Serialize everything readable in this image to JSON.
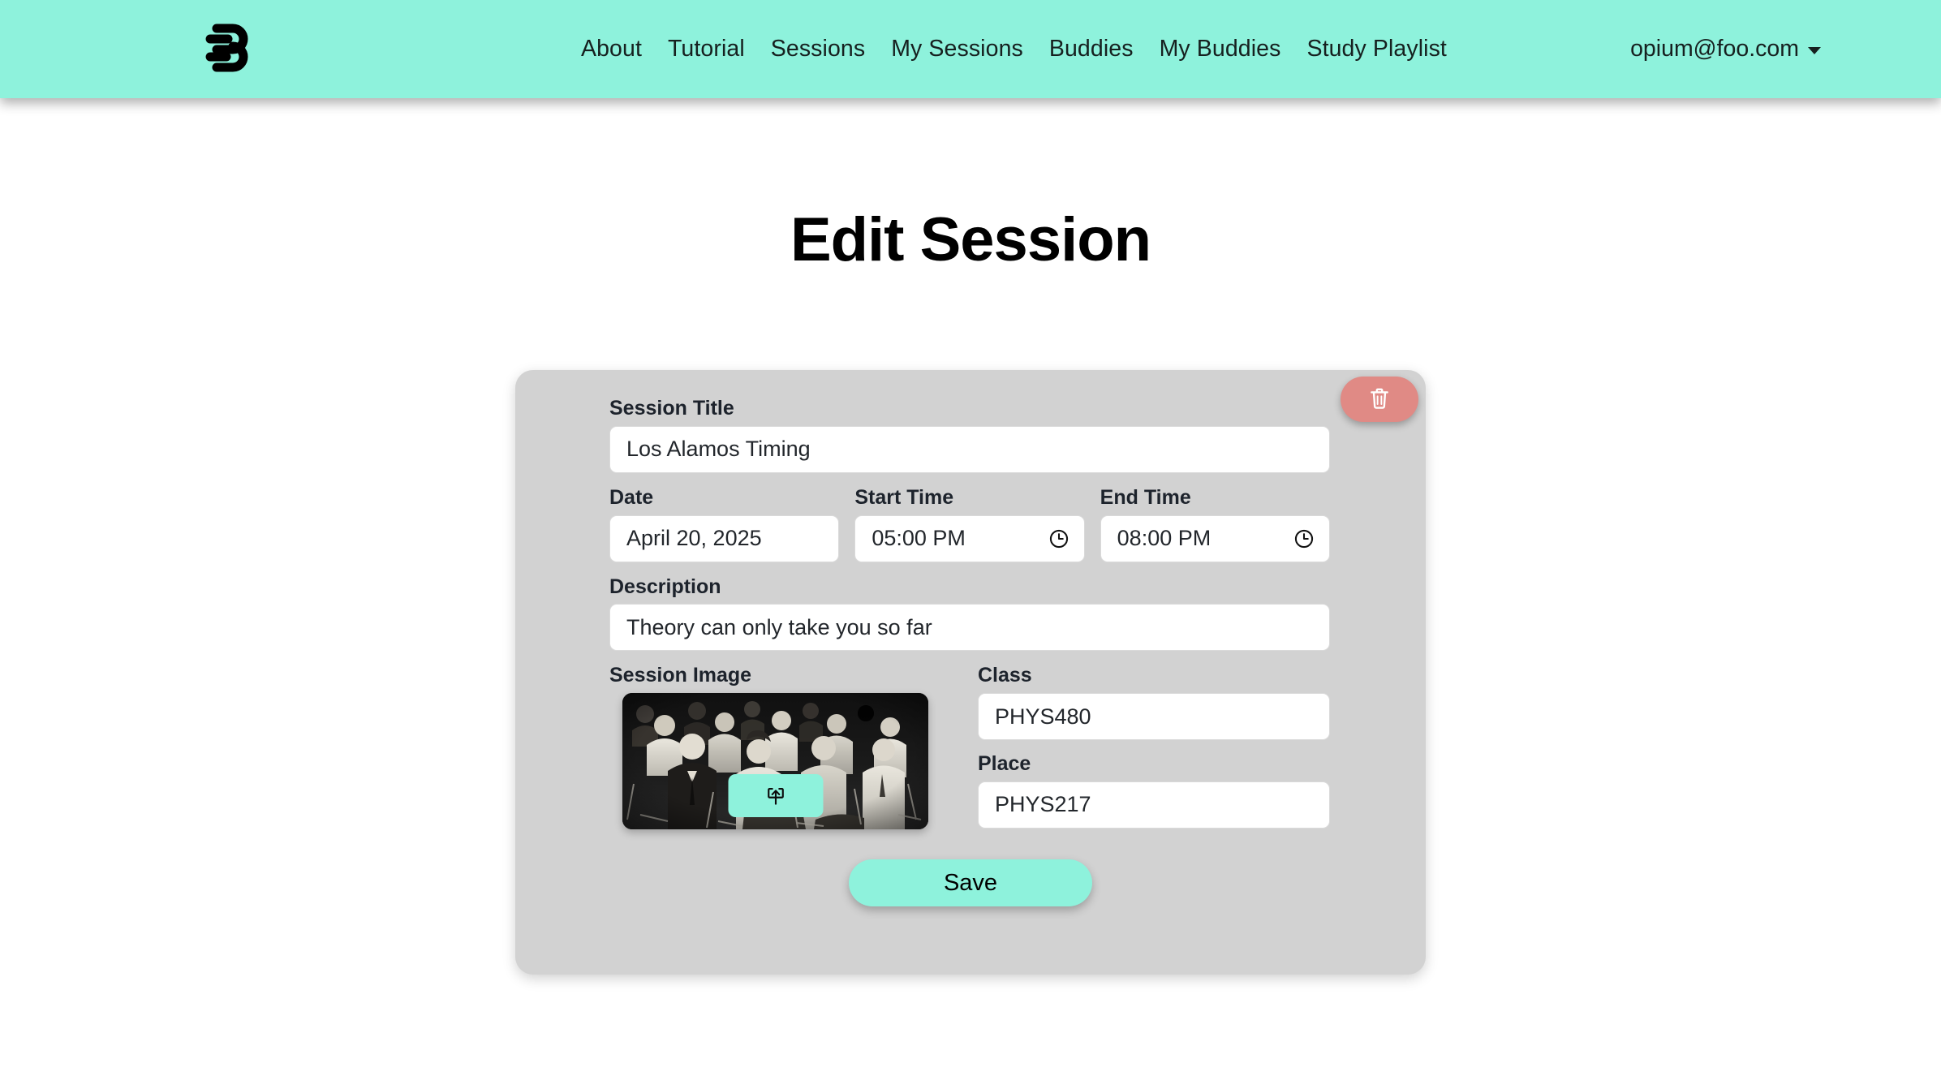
{
  "navbar": {
    "logo_icon": "studybuddy-logo-icon",
    "links": [
      {
        "label": "About"
      },
      {
        "label": "Tutorial"
      },
      {
        "label": "Sessions"
      },
      {
        "label": "My Sessions"
      },
      {
        "label": "Buddies"
      },
      {
        "label": "My Buddies"
      },
      {
        "label": "Study Playlist"
      }
    ],
    "user": {
      "email": "opium@foo.com",
      "caret_icon": "chevron-down-icon"
    },
    "background_color": "#8EF2DC"
  },
  "page": {
    "title": "Edit Session",
    "background_color": "#ffffff"
  },
  "card": {
    "background_color": "#d2d2d2",
    "delete_button": {
      "icon": "trash-icon",
      "color": "#e08a85"
    },
    "fields": {
      "session_title": {
        "label": "Session Title",
        "value": "Los Alamos Timing",
        "placeholder": "Session Title"
      },
      "date": {
        "label": "Date",
        "value": "April 20, 2025",
        "placeholder": "Date"
      },
      "start_time": {
        "label": "Start Time",
        "value": "05:00 PM",
        "placeholder": "Start Time",
        "icon": "clock-icon"
      },
      "end_time": {
        "label": "End Time",
        "value": "08:00 PM",
        "placeholder": "End Time",
        "icon": "clock-icon"
      },
      "description": {
        "label": "Description",
        "value": "Theory can only take you so far",
        "placeholder": "Description"
      },
      "session_image": {
        "label": "Session Image",
        "alt": "Black and white photo of an audience seated in folding chairs at a lecture",
        "upload_button_icon": "upload-icon"
      },
      "class": {
        "label": "Class",
        "value": "PHYS480",
        "placeholder": "Class"
      },
      "place": {
        "label": "Place",
        "value": "PHYS217",
        "placeholder": "Place"
      }
    },
    "save_button": {
      "label": "Save",
      "color": "#8EF2DC"
    }
  }
}
